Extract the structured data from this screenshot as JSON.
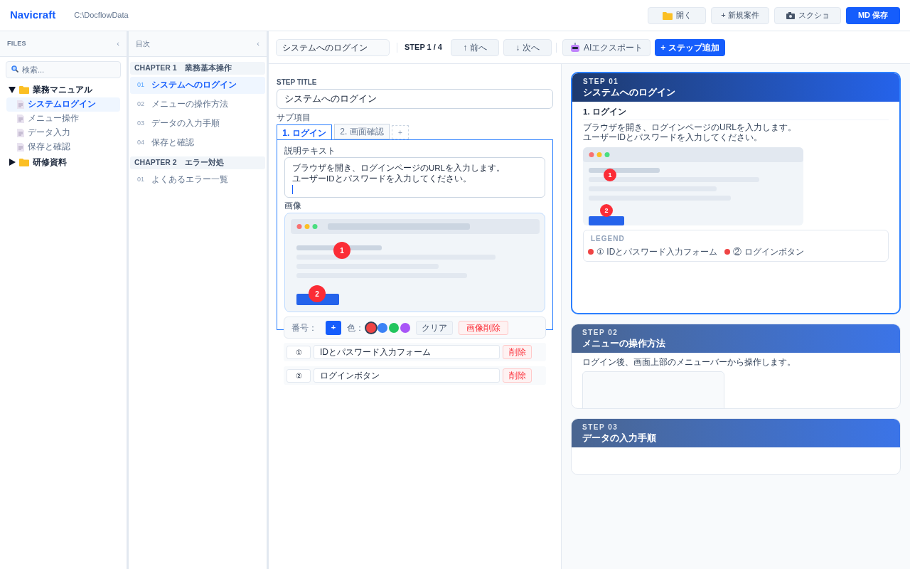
{
  "header": {
    "app_name": "Navicraft",
    "path": "C:\\DocflowData",
    "buttons": [
      {
        "label": "開く",
        "kind": "folder"
      },
      {
        "label": "+ 新規案件",
        "kind": "plain"
      },
      {
        "label": "スクショ",
        "kind": "camera"
      },
      {
        "label": "MD 保存",
        "kind": "primary"
      }
    ]
  },
  "files": {
    "title": "FILES",
    "collapse": "‹",
    "search": {
      "placeholder": "検索..."
    },
    "tree": [
      {
        "label": "業務マニュアル",
        "expanded": true,
        "children": [
          {
            "label": "システムログイン",
            "selected": true
          },
          {
            "label": "メニュー操作",
            "selected": false
          },
          {
            "label": "データ入力",
            "selected": false
          },
          {
            "label": "保存と確認",
            "selected": false
          }
        ]
      },
      {
        "label": "研修資料",
        "expanded": false
      }
    ]
  },
  "toc": {
    "title": "目次",
    "collapse": "‹",
    "chapters": [
      {
        "label": "CHAPTER 1　業務基本操作",
        "items": [
          {
            "number": "01",
            "label": "システムへのログイン",
            "selected": true
          },
          {
            "number": "02",
            "label": "メニューの操作方法",
            "selected": false
          },
          {
            "number": "03",
            "label": "データの入力手順",
            "selected": false
          },
          {
            "number": "04",
            "label": "保存と確認",
            "selected": false
          }
        ]
      },
      {
        "label": "CHAPTER 2　エラー対処",
        "items": [
          {
            "number": "01",
            "label": "よくあるエラー一覧",
            "selected": false
          }
        ]
      }
    ]
  },
  "toolbar": {
    "title_value": "システムへのログイン",
    "step": "STEP 1 / 4",
    "buttons": [
      {
        "label": "↑ 前へ",
        "kind": "plain"
      },
      {
        "label": "↓ 次へ",
        "kind": "plain"
      },
      {
        "label": "AIエクスポート",
        "kind": "robot"
      },
      {
        "label": "+ ステップ追加",
        "kind": "primary"
      }
    ]
  },
  "editor": {
    "step_title_label": "STEP TITLE",
    "step_title_value": "システムへのログイン",
    "sub_label": "サブ項目",
    "subtabs": [
      {
        "label": "1. ログイン",
        "selected": true
      },
      {
        "label": "2. 画面確認",
        "selected": false
      }
    ],
    "add_tab": "+",
    "description_label": "説明テキスト",
    "description": [
      "ブラウザを開き、ログインページのURLを入力します。",
      "ユーザーIDとパスワードを入力してください。"
    ],
    "image_label": "画像",
    "markers": [
      "1",
      "2"
    ],
    "tools": {
      "number_label": "番号：",
      "add": "+",
      "color_label": "色：",
      "colors": [
        {
          "color": "#ef4444",
          "selected": true
        },
        {
          "color": "#3b82f6",
          "selected": false
        },
        {
          "color": "#22c55e",
          "selected": false
        },
        {
          "color": "#a855f7",
          "selected": false
        }
      ],
      "clear": "クリア",
      "delete_image": "画像削除"
    },
    "annotations": [
      {
        "mark": "①",
        "text": "IDとパスワード入力フォーム",
        "delete": "削除"
      },
      {
        "mark": "②",
        "text": "ログインボタン",
        "delete": "削除"
      }
    ]
  },
  "preview": [
    {
      "step": "STEP 01",
      "title": "システムへのログイン",
      "selected": true,
      "subtitle": "1. ログイン",
      "text": [
        "ブラウザを開き、ログインページのURLを入力します。",
        "ユーザーIDとパスワードを入力してください。"
      ],
      "markers": [
        "1",
        "2"
      ],
      "legend": {
        "title": "LEGEND",
        "items": [
          {
            "mark": "① IDとパスワード入力フォーム",
            "color": "#ef4444"
          },
          {
            "mark": "② ログインボタン",
            "color": "#ef4444"
          }
        ]
      }
    },
    {
      "step": "STEP 02",
      "title": "メニューの操作方法",
      "selected": false,
      "text": [
        "ログイン後、画面上部のメニューバーから操作します。"
      ]
    },
    {
      "step": "STEP 03",
      "title": "データの入力手順",
      "selected": false
    }
  ]
}
